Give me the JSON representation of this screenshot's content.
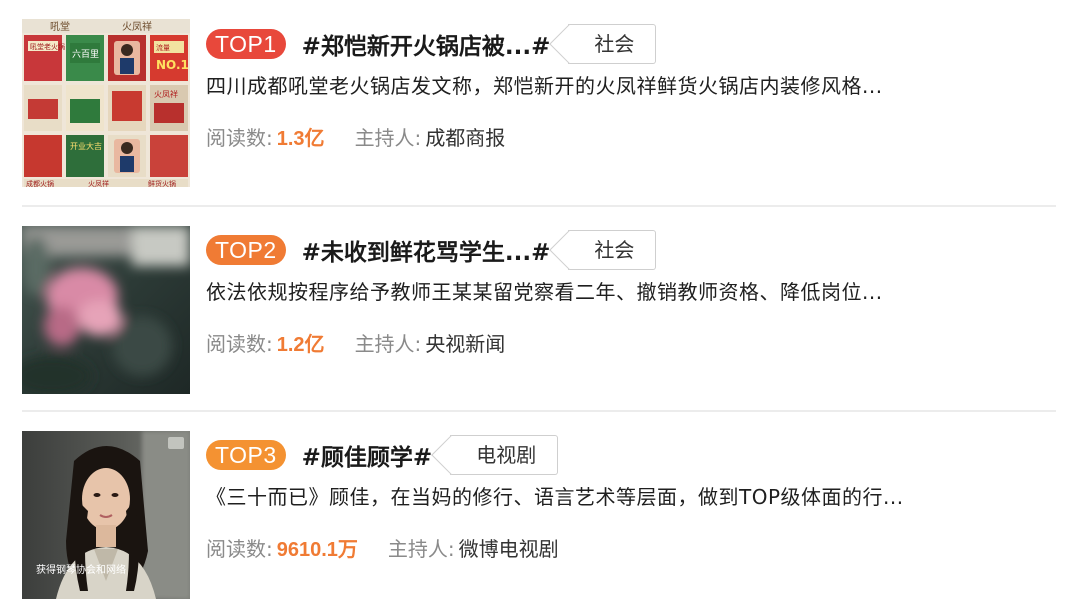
{
  "topics": [
    {
      "rank": "TOP1",
      "title": "#郑恺新开火锅店被...#",
      "category": "社会",
      "summary": "四川成都吼堂老火锅店发文称，郑恺新开的火凤祥鲜货火锅店内装修风格...",
      "read_label": "阅读数:",
      "read_count": "1.3亿",
      "host_label": "主持人:",
      "host": "成都商报",
      "thumb_texts": [
        "吼堂",
        "火凤祥",
        "吼堂老火锅",
        "六百里",
        "流量",
        "NO.1",
        "火凤祥",
        "开业大吉",
        "成都火锅",
        "火凤祥",
        "鲜货火锅"
      ]
    },
    {
      "rank": "TOP2",
      "title": "#未收到鲜花骂学生...#",
      "category": "社会",
      "summary": "依法依规按程序给予教师王某某留党察看二年、撤销教师资格、降低岗位...",
      "read_label": "阅读数:",
      "read_count": "1.2亿",
      "host_label": "主持人:",
      "host": "央视新闻"
    },
    {
      "rank": "TOP3",
      "title": "#顾佳顾学#",
      "category": "电视剧",
      "summary": "《三十而已》顾佳，在当妈的修行、语言艺术等层面，做到TOP级体面的行...",
      "read_label": "阅读数:",
      "read_count": "9610.1万",
      "host_label": "主持人:",
      "host": "微博电视剧",
      "thumb_caption": "获得钢琴协会和网络"
    }
  ],
  "colors": {
    "top1_badge": "#e8483b",
    "top2_badge": "#f07b34",
    "top3_badge": "#f49232",
    "read_count": "#f07b34",
    "meta_label": "#8a8a8a"
  }
}
